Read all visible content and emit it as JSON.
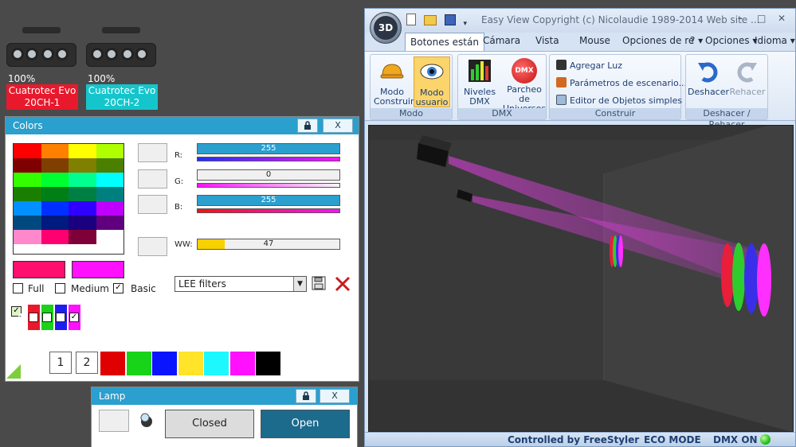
{
  "fixtures": [
    {
      "percent": "100%",
      "label_line1": "Cuatrotec Evo",
      "label_line2": "20CH-1",
      "color": "#e8192c"
    },
    {
      "percent": "100%",
      "label_line1": "Cuatrotec Evo",
      "label_line2": "20CH-2",
      "color": "#14c6cc"
    }
  ],
  "colors_panel": {
    "title": "Colors",
    "lock_icon": "lock-icon",
    "close_label": "X",
    "grid_colors": [
      "#ff0000",
      "#ff8000",
      "#ffff00",
      "#b0ff00",
      "#7f0000",
      "#7f3f00",
      "#7f7f00",
      "#4a7f00",
      "#33ff00",
      "#00ff30",
      "#00ff90",
      "#00ffff",
      "#1a7f00",
      "#007f17",
      "#007f45",
      "#007f7f",
      "#0090ff",
      "#0030ff",
      "#3000ff",
      "#c000ff",
      "#00497f",
      "#001a7f",
      "#1a007f",
      "#60007f",
      "#ff88cc",
      "#ff0070",
      "#7f0038",
      "#ffffff"
    ],
    "r_label": "R:",
    "r_value": "255",
    "r_fill": 1.0,
    "g_label": "G:",
    "g_value": "0",
    "g_fill": 0.0,
    "b_label": "B:",
    "b_value": "255",
    "b_fill": 1.0,
    "ww_label": "WW:",
    "ww_value": "47",
    "ww_fill": 0.19,
    "color_a": "#ff0f6e",
    "color_b": "#ff10ff",
    "full_label": "Full",
    "medium_label": "Medium",
    "basic_label": "Basic",
    "filter_select": "LEE filters",
    "save_icon": "save-icon",
    "delete_icon": "delete-x-icon",
    "channel_colors": [
      "#e8192c",
      "#19d219",
      "#1d1df2",
      "#ff10ff"
    ],
    "page_buttons": [
      "1",
      "2"
    ],
    "bottom_swatches": [
      "#e00000",
      "#18d418",
      "#0a14ff",
      "#ffe42a",
      "#1df8ff",
      "#ff10ff",
      "#000000"
    ]
  },
  "lamp_panel": {
    "title": "Lamp",
    "close_label": "X",
    "closed_label": "Closed",
    "open_label": "Open"
  },
  "app": {
    "orb_label": "3D",
    "title": "Easy View   Copyright (c) Nicolaudie 1989-2014   Web site ...",
    "win_min": "–",
    "win_max": "□",
    "win_close": "✕",
    "tabs": [
      "Botones están",
      "Cámara",
      "Vista",
      "Mouse",
      "Opciones de re"
    ],
    "help_tab": "? ▾",
    "options_tab": "Opciones ▾",
    "language_tab": "Idioma ▾",
    "groups": {
      "modo": {
        "label": "Modo",
        "btn1": "Modo Construir",
        "btn2": "Modo usuario"
      },
      "dmx": {
        "label": "DMX",
        "btn1": "Niveles DMX",
        "btn2": "Parcheo de Universos",
        "dmx_badge": "DMX"
      },
      "construir": {
        "label": "Construir",
        "item1": "Agregar Luz",
        "item2": "Parámetros de escenario...",
        "item3": "Editor de Objetos simples"
      },
      "deshacer": {
        "label": "Deshacer / Rehacer",
        "undo": "Deshacer",
        "redo": "Rehacer"
      }
    },
    "status": {
      "controlled": "Controlled by FreeStyler",
      "eco": "ECO MODE",
      "dmx": "DMX ON"
    }
  }
}
